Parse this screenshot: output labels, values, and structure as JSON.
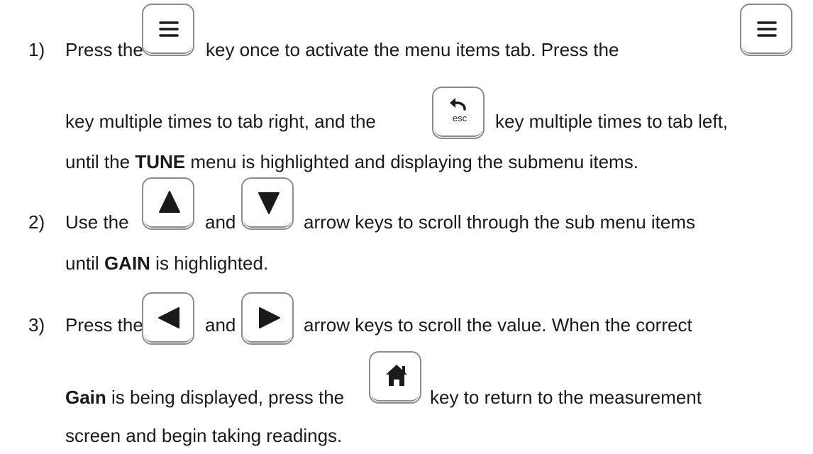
{
  "step1": {
    "num": "1)",
    "press_the_a": "Press the",
    "key_once": "key once to activate the menu items tab.  Press the",
    "key_multiple_right": "key multiple times to tab right, and the",
    "key_multiple_left": "key multiple times to tab left,",
    "until_the": "until the",
    "tune": "TUNE",
    "menu_rest": "menu is highlighted and displaying the submenu items."
  },
  "step2": {
    "num": "2)",
    "use_the": "Use the",
    "and": "and",
    "arrow_rest": "arrow keys to scroll through the sub menu items",
    "until": "until",
    "gain": "GAIN",
    "is_highlighted": "is highlighted."
  },
  "step3": {
    "num": "3)",
    "press_the": "Press the",
    "and": "and",
    "arrow_rest": "arrow keys to scroll the value.  When the correct",
    "gain": "Gain",
    "is_being": "is being displayed, press the",
    "key_return": "key to return to the measurement",
    "screen_rest": "screen and begin taking readings."
  },
  "keys": {
    "esc_label": "esc",
    "icons": [
      "menu-icon",
      "menu-icon",
      "back-esc-icon",
      "up-arrow-icon",
      "down-arrow-icon",
      "left-arrow-icon",
      "right-arrow-icon",
      "home-icon"
    ]
  },
  "colors": {
    "text": "#1a1a1a",
    "key_border": "#8c8c8c",
    "glyph": "#1a1a1a"
  }
}
